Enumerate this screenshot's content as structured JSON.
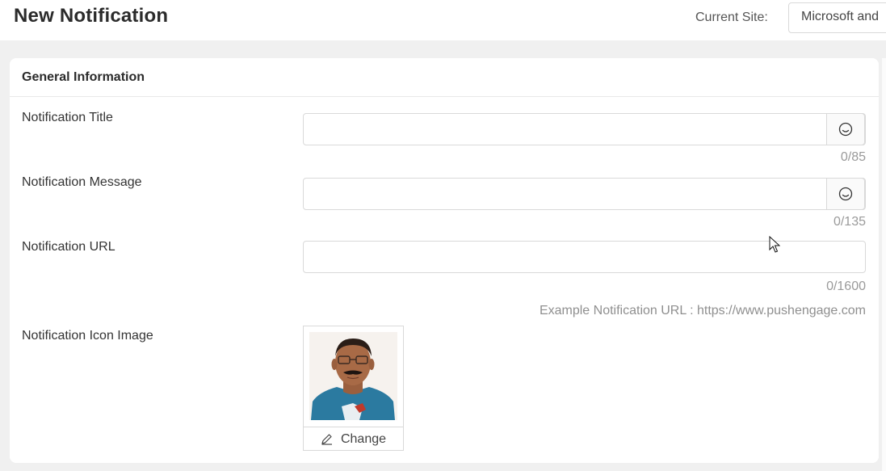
{
  "header": {
    "title": "New Notification",
    "current_site_label": "Current Site:",
    "current_site_value": "Microsoft and"
  },
  "section": {
    "title": "General Information"
  },
  "fields": {
    "title": {
      "label": "Notification Title",
      "value": "",
      "counter": "0/85",
      "icon": "smiley-icon"
    },
    "message": {
      "label": "Notification Message",
      "value": "",
      "counter": "0/135",
      "icon": "smiley-icon"
    },
    "url": {
      "label": "Notification URL",
      "value": "",
      "counter": "0/1600",
      "hint": "Example Notification URL : https://www.pushengage.com"
    },
    "icon_image": {
      "label": "Notification Icon Image",
      "change_label": "Change",
      "change_icon": "pencil-icon"
    }
  },
  "colors": {
    "background": "#f0f0f0",
    "card": "#ffffff",
    "border": "#d9d9d9",
    "muted_text": "#9a9a9a"
  }
}
